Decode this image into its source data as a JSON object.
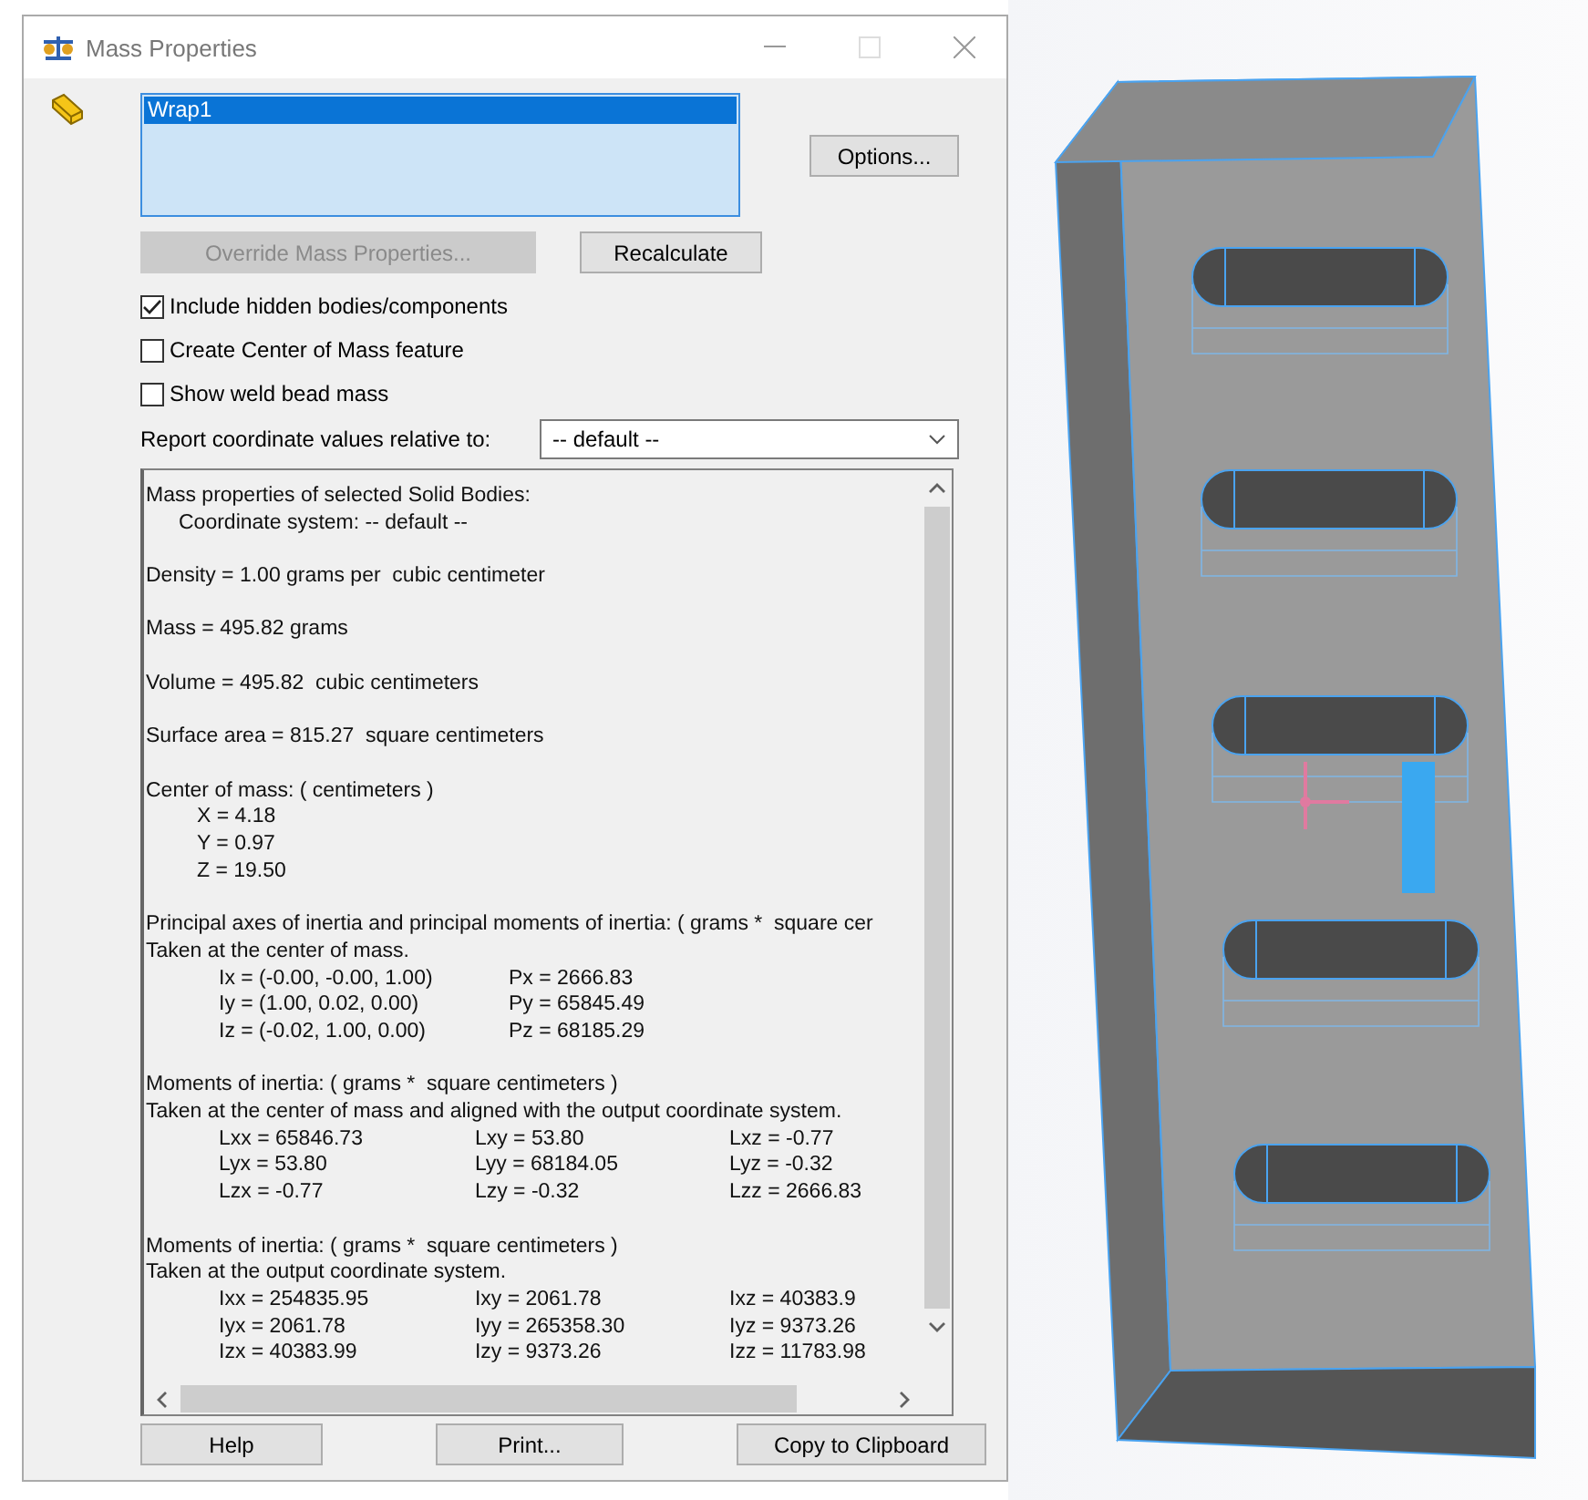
{
  "window": {
    "title": "Mass Properties"
  },
  "selection_list": {
    "items": [
      {
        "label": "Wrap1",
        "selected": true
      }
    ]
  },
  "buttons": {
    "options": {
      "label": "Options...",
      "disabled": false
    },
    "override": {
      "label": "Override Mass Properties...",
      "disabled": true
    },
    "recalculate": {
      "label": "Recalculate",
      "disabled": false
    }
  },
  "checkboxes": [
    {
      "label": "Include hidden bodies/components",
      "checked": true
    },
    {
      "label": "Create Center of Mass feature",
      "checked": false
    },
    {
      "label": "Show weld bead mass",
      "checked": false
    }
  ],
  "coordinate": {
    "label": "Report coordinate values relative to:",
    "value": "-- default --"
  },
  "report": {
    "sections": [
      {
        "lines": [
          {
            "kind": "text",
            "text": "Mass properties of selected Solid Bodies:"
          },
          {
            "kind": "indent",
            "text": "Coordinate system: -- default --"
          }
        ]
      },
      {
        "lines": [
          {
            "kind": "text",
            "text": "Density = 1.00 grams per  cubic centimeter"
          }
        ]
      },
      {
        "lines": [
          {
            "kind": "text",
            "text": "Mass = 495.82 grams"
          }
        ]
      },
      {
        "lines": [
          {
            "kind": "text",
            "text": "Volume = 495.82  cubic centimeters"
          }
        ]
      },
      {
        "lines": [
          {
            "kind": "text",
            "text": "Surface area = 815.27  square centimeters"
          }
        ]
      },
      {
        "lines": [
          {
            "kind": "text",
            "text": "Center of mass: ( centimeters )"
          },
          {
            "kind": "indent",
            "text": "X = 4.18"
          },
          {
            "kind": "indent",
            "text": "Y = 0.97"
          },
          {
            "kind": "indent",
            "text": "Z = 19.50"
          }
        ]
      },
      {
        "lines": [
          {
            "kind": "text",
            "text": "Principal axes of inertia and principal moments of inertia: ( grams *  square cer"
          },
          {
            "kind": "text",
            "text": "Taken at the center of mass."
          },
          {
            "kind": "row",
            "cells": [
              "Ix = (-0.00, -0.00, 1.00)",
              "Px = 2666.83"
            ]
          },
          {
            "kind": "row",
            "cells": [
              "Iy = (1.00, 0.02, 0.00)",
              "Py = 65845.49"
            ]
          },
          {
            "kind": "row",
            "cells": [
              "Iz = (-0.02, 1.00, 0.00)",
              "Pz = 68185.29"
            ]
          }
        ]
      },
      {
        "lines": [
          {
            "kind": "text",
            "text": "Moments of inertia: ( grams *  square centimeters )"
          },
          {
            "kind": "text",
            "text": "Taken at the center of mass and aligned with the output coordinate system."
          },
          {
            "kind": "row",
            "cells": [
              "Lxx = 65846.73",
              "Lxy = 53.80",
              "Lxz = -0.77"
            ]
          },
          {
            "kind": "row",
            "cells": [
              "Lyx = 53.80",
              "Lyy = 68184.05",
              "Lyz = -0.32"
            ]
          },
          {
            "kind": "row",
            "cells": [
              "Lzx = -0.77",
              "Lzy = -0.32",
              "Lzz = 2666.83"
            ]
          }
        ]
      },
      {
        "lines": [
          {
            "kind": "text",
            "text": "Moments of inertia: ( grams *  square centimeters )"
          },
          {
            "kind": "text",
            "text": "Taken at the output coordinate system."
          },
          {
            "kind": "row",
            "cells": [
              "Ixx = 254835.95",
              "Ixy = 2061.78",
              "Ixz = 40383.9"
            ]
          },
          {
            "kind": "row",
            "cells": [
              "Iyx = 2061.78",
              "Iyy = 265358.30",
              "Iyz = 9373.26"
            ]
          },
          {
            "kind": "row",
            "cells": [
              "Izx = 40383.99",
              "Izy = 9373.26",
              "Izz = 11783.98"
            ]
          }
        ]
      }
    ]
  },
  "footer_buttons": [
    "Help",
    "Print...",
    "Copy to Clipboard"
  ]
}
